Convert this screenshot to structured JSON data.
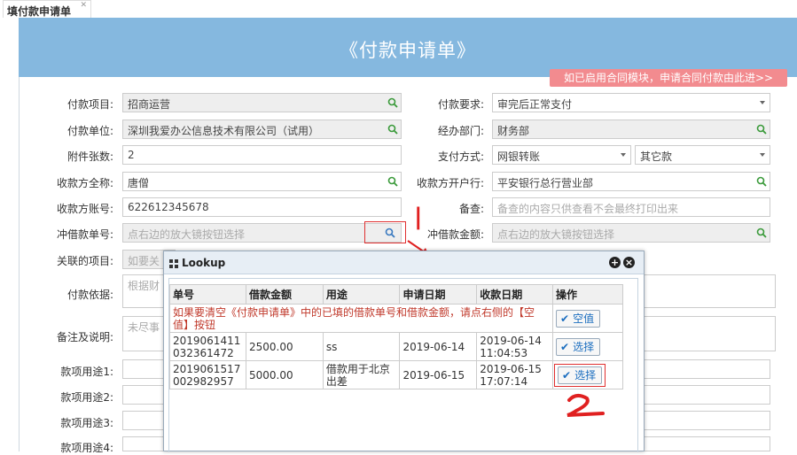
{
  "tab": {
    "label": "填付款申请单"
  },
  "header": {
    "title": "《付款申请单》",
    "contract_link": "如已启用合同模块，申请合同付款由此进>>"
  },
  "form": {
    "left": {
      "pay_item_label": "付款项目:",
      "pay_item_value": "招商运营",
      "pay_unit_label": "付款单位:",
      "pay_unit_value": "深圳我爱办公信息技术有限公司（试用）",
      "attach_label": "附件张数:",
      "attach_value": "2",
      "payee_name_label": "收款方全称:",
      "payee_name_value": "唐僧",
      "payee_acct_label": "收款方账号:",
      "payee_acct_value": "622612345678",
      "offset_no_label": "冲借款单号:",
      "offset_no_placeholder": "点右边的放大镜按钮选择",
      "related_label": "关联的项目:",
      "related_placeholder": "如要关",
      "basis_label": "付款依据:",
      "basis_placeholder": "根据财",
      "remark_label": "备注及说明:",
      "remark_placeholder": "未尽事",
      "use1_label": "款项用途1:",
      "use2_label": "款项用途2:",
      "use3_label": "款项用途3:",
      "use4_label": "款项用途4:"
    },
    "right": {
      "req_label": "付款要求:",
      "req_value": "审完后正常支付",
      "dept_label": "经办部门:",
      "dept_value": "财务部",
      "method_label": "支付方式:",
      "method_value": "网银转账",
      "method2_value": "其它款",
      "bank_label": "收款方开户行:",
      "bank_value": "平安银行总行营业部",
      "memo_label": "备查:",
      "memo_placeholder": "备查的内容只供查看不会最终打印出来",
      "offset_amt_label": "冲借款金额:",
      "offset_amt_placeholder": "点右边的放大镜按钮选择"
    }
  },
  "dialog": {
    "title": "Lookup",
    "columns": [
      "单号",
      "借款金额",
      "用途",
      "申请日期",
      "收款日期",
      "操作"
    ],
    "clear_note": "如果要清空《付款申请单》中的已填的借款单号和借款金额，请点右侧的【空值】按钮",
    "clear_button": "空值",
    "rows": [
      {
        "no": "2019061411032361472",
        "no_a": "2019061411",
        "no_b": "032361472",
        "amount": "2500.00",
        "use": "ss",
        "apply_date": "2019-06-14",
        "recv_a": "2019-06-14",
        "recv_b": "11:04:53",
        "action": "选择"
      },
      {
        "no": "2019061517002982957",
        "no_a": "2019061517",
        "no_b": "002982957",
        "amount": "5000.00",
        "use": "借款用于北京出差",
        "use_a": "借款用于北京",
        "use_b": "出差",
        "apply_date": "2019-06-15",
        "recv_a": "2019-06-15",
        "recv_b": "17:07:14",
        "action": "选择"
      }
    ]
  },
  "colors": {
    "header_bg": "#85b8df",
    "link_bg": "#f28b8f",
    "annotation": "#e02020",
    "button_text": "#1a6dbf"
  }
}
